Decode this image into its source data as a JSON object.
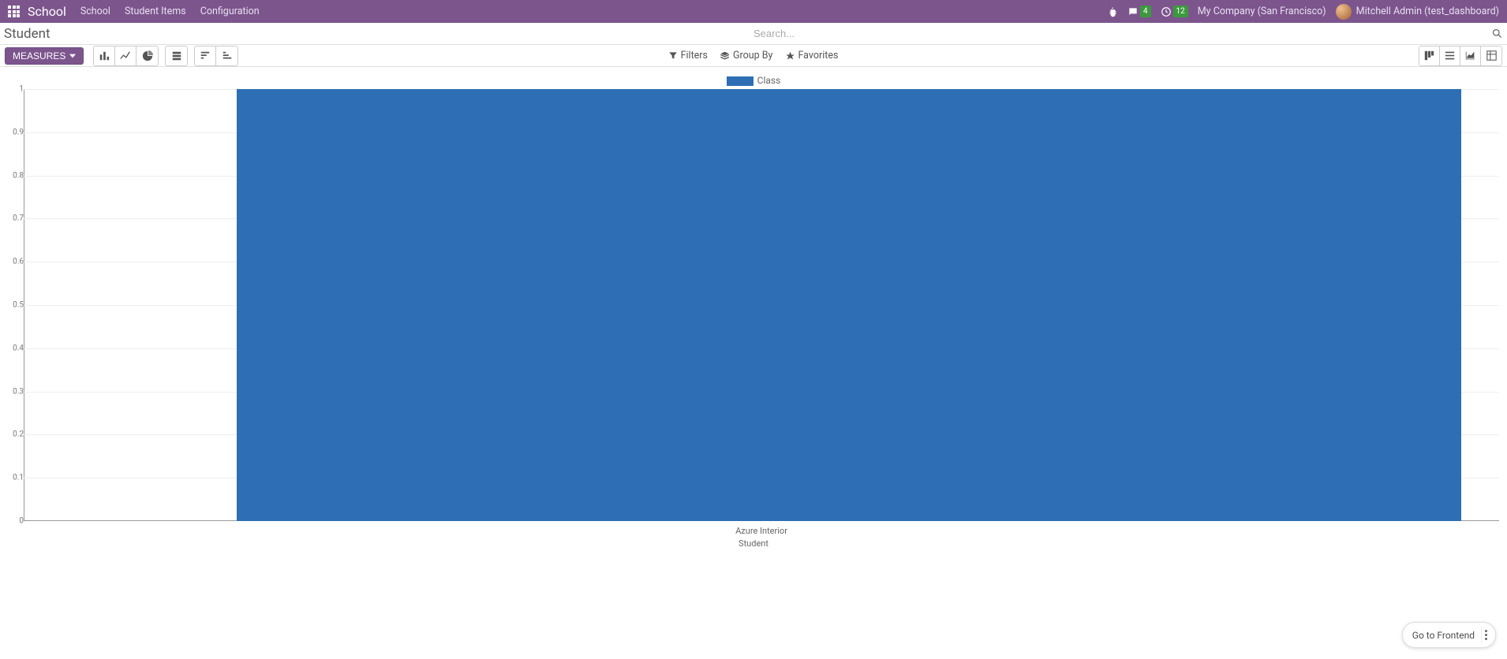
{
  "navbar": {
    "brand": "School",
    "menu": [
      "School",
      "Student Items",
      "Configuration"
    ],
    "messages_badge": "4",
    "activities_badge": "12",
    "company": "My Company (San Francisco)",
    "user": "Mitchell Admin (test_dashboard)"
  },
  "breadcrumb": "Student",
  "search": {
    "placeholder": "Search..."
  },
  "toolbar": {
    "measures_label": "MEASURES",
    "filters": "Filters",
    "group_by": "Group By",
    "favorites": "Favorites"
  },
  "chart_data": {
    "type": "bar",
    "categories": [
      "Azure Interior"
    ],
    "series": [
      {
        "name": "Class",
        "values": [
          1
        ]
      }
    ],
    "xlabel": "Student",
    "ylabel": "",
    "ylim": [
      0,
      1
    ],
    "y_ticks": [
      0,
      0.1,
      0.2,
      0.3,
      0.4,
      0.5,
      0.6,
      0.7,
      0.8,
      0.9,
      1
    ],
    "legend": "Class",
    "colors": {
      "bar": "#2e6eb5"
    }
  },
  "frontend_button": "Go to Frontend"
}
